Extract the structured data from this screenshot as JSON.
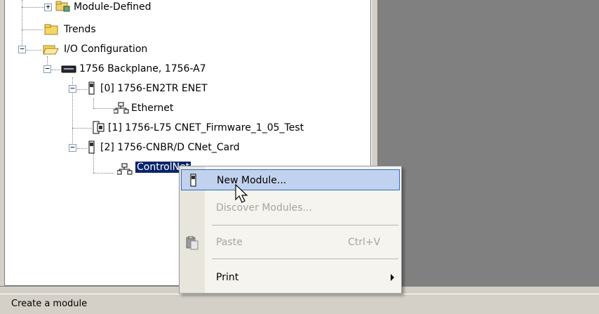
{
  "tree": {
    "items": [
      {
        "label": "Module-Defined"
      },
      {
        "label": "Trends"
      },
      {
        "label": "I/O Configuration"
      },
      {
        "label": "1756 Backplane, 1756-A7"
      },
      {
        "label": "[0] 1756-EN2TR ENET"
      },
      {
        "label": "Ethernet"
      },
      {
        "label": "[1] 1756-L75 CNET_Firmware_1_05_Test"
      },
      {
        "label": "[2] 1756-CNBR/D CNet_Card"
      },
      {
        "label": "ControlNet"
      }
    ],
    "expanders": {
      "plus": "+",
      "minus": "−"
    }
  },
  "context_menu": {
    "items": [
      {
        "label": "New Module...",
        "state": "highlighted",
        "icon": "module-icon"
      },
      {
        "label": "Discover Modules...",
        "state": "disabled"
      },
      {
        "label": "Paste",
        "shortcut": "Ctrl+V",
        "state": "disabled",
        "icon": "paste-icon"
      },
      {
        "label": "Print",
        "state": "enabled",
        "submenu": true
      }
    ]
  },
  "statusbar": {
    "text": "Create a module"
  },
  "colors": {
    "selection": "#0a246a",
    "menu_highlight": "#c1d2ee",
    "workspace": "#808080",
    "chrome": "#d4d0c8"
  }
}
